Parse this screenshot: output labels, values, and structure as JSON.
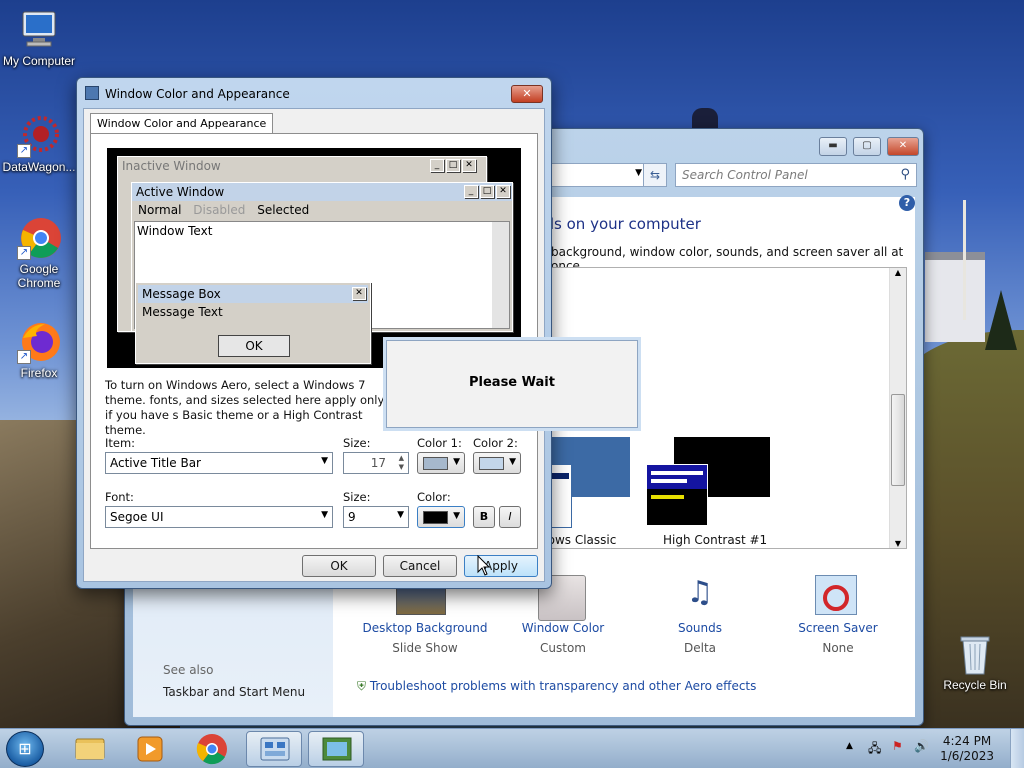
{
  "desktop": {
    "icons": [
      {
        "label": "My Computer"
      },
      {
        "label": "DataWagon..."
      },
      {
        "label": "Google Chrome"
      },
      {
        "label": "Firefox"
      },
      {
        "label": "Recycle Bin"
      }
    ]
  },
  "control_panel": {
    "search_placeholder": "Search Control Panel",
    "heading": "nds on your computer",
    "subtext": "background, window color, sounds, and screen saver all at once.",
    "themes": [
      {
        "label": "dows Classic"
      },
      {
        "label": "High Contrast #1"
      }
    ],
    "bottom_items": [
      {
        "title": "Desktop Background",
        "sub": "Slide Show",
        "icon": "desktop-background-icon"
      },
      {
        "title": "Window Color",
        "sub": "Custom",
        "icon": "window-color-icon"
      },
      {
        "title": "Sounds",
        "sub": "Delta",
        "icon": "sounds-icon"
      },
      {
        "title": "Screen Saver",
        "sub": "None",
        "icon": "screen-saver-icon"
      }
    ],
    "see_also": "See also",
    "taskbar_link": "Taskbar and Start Menu",
    "troubleshoot": "Troubleshoot problems with transparency and other Aero effects"
  },
  "dialog": {
    "title": "Window Color and Appearance",
    "tab": "Window Color and Appearance",
    "preview": {
      "inactive_title": "Inactive Window",
      "active_title": "Active Window",
      "menu_normal": "Normal",
      "menu_disabled": "Disabled",
      "menu_selected": "Selected",
      "window_text": "Window Text",
      "msg_title": "Message Box",
      "msg_text": "Message Text",
      "ok": "OK"
    },
    "instructions": "To turn on Windows Aero, select a Windows 7 theme. fonts, and sizes selected here apply only if you have s Basic theme or a High Contrast theme.",
    "item_label": "Item:",
    "item_value": "Active Title Bar",
    "size_label": "Size:",
    "size_value": "17",
    "color1_label": "Color 1:",
    "color2_label": "Color 2:",
    "color1_swatch": "#a6b8cc",
    "color2_swatch": "#c3d6ea",
    "font_label": "Font:",
    "font_value": "Segoe UI",
    "font_size_label": "Size:",
    "font_size_value": "9",
    "font_color_label": "Color:",
    "font_color_swatch": "#000000",
    "bold": "B",
    "italic": "I",
    "ok": "OK",
    "cancel": "Cancel",
    "apply": "Apply"
  },
  "please_wait": "Please Wait",
  "taskbar": {
    "time": "4:24 PM",
    "date": "1/6/2023"
  }
}
